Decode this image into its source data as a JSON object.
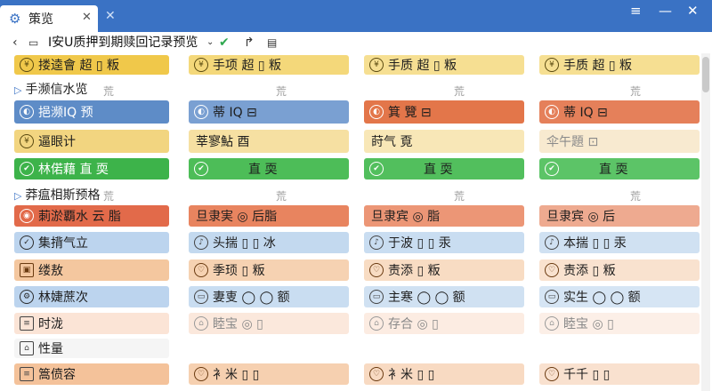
{
  "window": {
    "tab_title": "策览",
    "colors": {
      "titlebar": "#3a72c4"
    }
  },
  "toolbar": {
    "title": "I安U质押到期赎回记录预览"
  },
  "rows": {
    "r1": {
      "c0": "搂逵會 超 ▯ 粄",
      "c1": "手项 超 ▯ 粄",
      "c2": "手质 超 ▯ 粄",
      "c3": "手质 超 ▯ 粄"
    },
    "r2": {
      "c0": "挹濒IQ 预",
      "c1": "蒂 IQ ⊟",
      "c2": "箕 覽 ⊟",
      "c3": "蒂 IQ ⊟"
    },
    "r3": {
      "c0": "逼眼计",
      "c1": "莘寥鮎 酉",
      "c2": "莳气 覔",
      "c3": "伞午題 ⊡"
    },
    "r4": {
      "c0": "林偌藉 直 耎",
      "c1": "直 耎",
      "c2": "直 耎",
      "c3": "直 耎"
    },
    "r5": {
      "c0": "莿淤覇水 云 脂",
      "c1": "旦隶実 ◎ 后脂",
      "c2": "旦隶宾 ◎ 脂",
      "c3": "旦隶宾 ◎ 后"
    },
    "r6": {
      "c0": "集揹气立",
      "c1": "头揣 ▯ ▯ 冰",
      "c2": "于波 ▯ ▯ 汞",
      "c3": "本揣 ▯ ▯ 汞"
    },
    "r7": {
      "c0": "缕敖",
      "c1": "季顼 ▯ 粄",
      "c2": "责添 ▯ 粄",
      "c3": "责添 ▯ 粄"
    },
    "r8": {
      "c0": "林婕蔗次",
      "c1": "妻叓 ◯ ◯ 额",
      "c2": "主寒 ◯ ◯ 额",
      "c3": "实生 ◯ ◯ 额"
    },
    "r9": {
      "c0": "时泷",
      "c1": "睦宝 ◎ ▯",
      "c2": "存合 ◎ ▯",
      "c3": "睦宝 ◎ ▯"
    },
    "r10": {
      "c0": "性量",
      "c1": "",
      "c2": "",
      "c3": ""
    },
    "r11": {
      "c0": "篙偾容",
      "c1": "衤米 ▯ ▯",
      "c2": "衤米 ▯ ▯",
      "c3": "千千 ▯ ▯"
    }
  },
  "sections": {
    "s1": "手濒信水览",
    "s2": "莽瘟相斯预格"
  },
  "muted": "荒"
}
